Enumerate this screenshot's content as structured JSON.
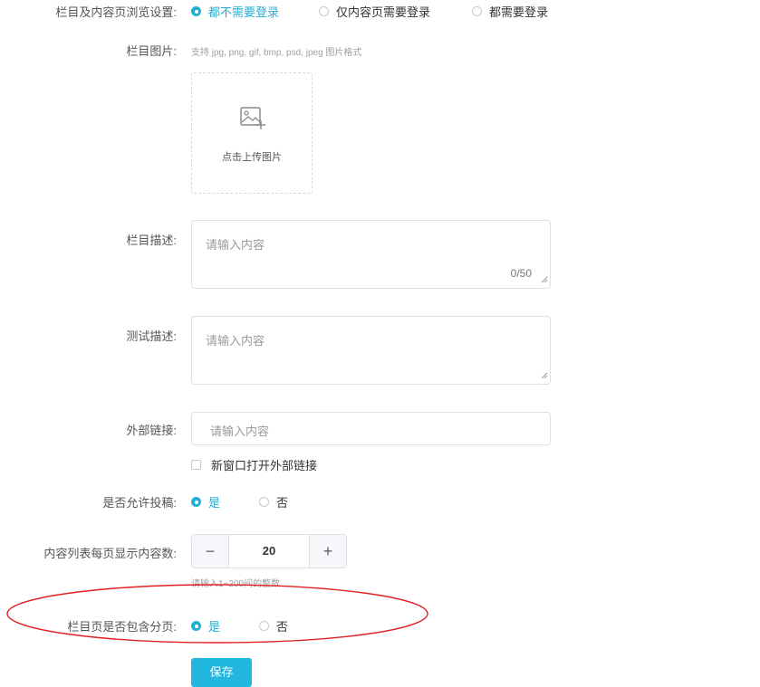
{
  "browse_setting": {
    "label": "栏目及内容页浏览设置:",
    "options": [
      "都不需要登录",
      "仅内容页需要登录",
      "都需要登录"
    ],
    "selected": "都不需要登录"
  },
  "image": {
    "label": "栏目图片:",
    "hint": "支持 jpg, png, gif, bmp, psd, jpeg 图片格式",
    "upload_text": "点击上传图片"
  },
  "description": {
    "label": "栏目描述:",
    "placeholder": "请输入内容",
    "counter": "0/50"
  },
  "test_description": {
    "label": "测试描述:",
    "placeholder": "请输入内容"
  },
  "external_link": {
    "label": "外部链接:",
    "placeholder": "请输入内容",
    "new_window_label": "新窗口打开外部链接",
    "new_window_checked": false
  },
  "allow_submission": {
    "label": "是否允许投稿:",
    "options": [
      "是",
      "否"
    ],
    "selected": "是"
  },
  "page_size": {
    "label": "内容列表每页显示内容数:",
    "value": "20",
    "hint": "请输入1~200间的整数"
  },
  "pagination": {
    "label": "栏目页是否包含分页:",
    "options": [
      "是",
      "否"
    ],
    "selected": "是"
  },
  "save_label": "保存",
  "colors": {
    "accent": "#23aed6",
    "button": "#22b7de",
    "annotation": "#e02020"
  },
  "icons": {
    "upload": "image-plus-icon",
    "minus": "minus-icon",
    "plus": "plus-icon"
  }
}
